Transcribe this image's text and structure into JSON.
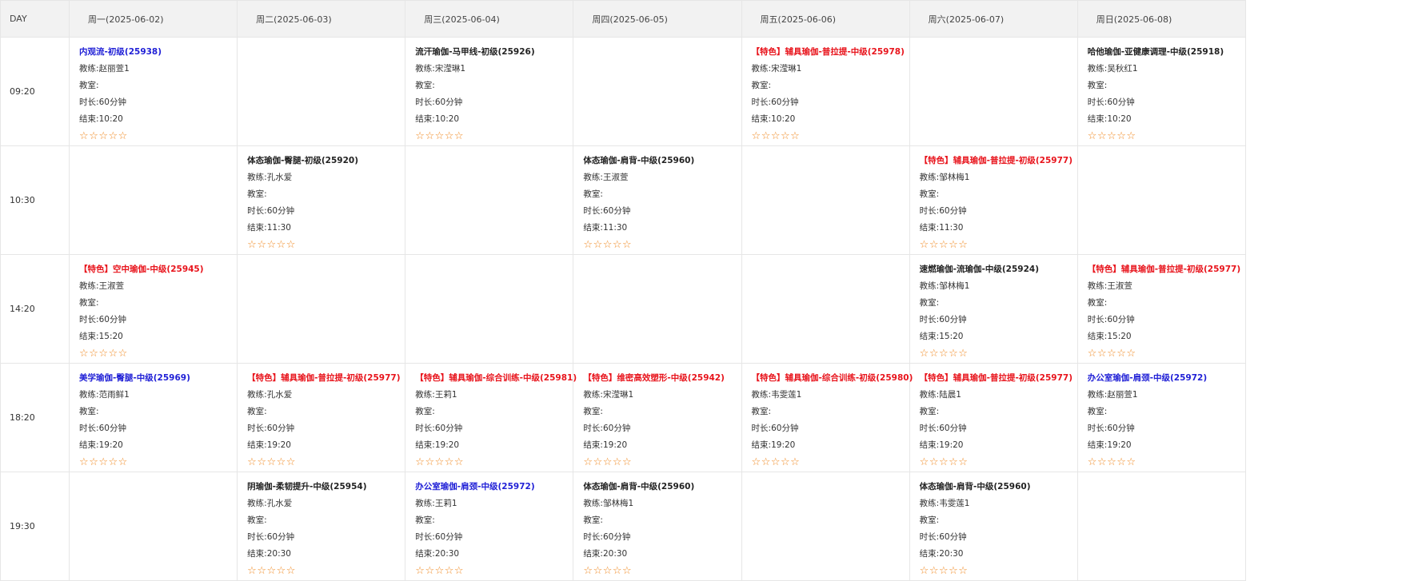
{
  "header": {
    "day_label": "DAY",
    "days": [
      "周一(2025-06-02)",
      "周二(2025-06-03)",
      "周三(2025-06-04)",
      "周四(2025-06-05)",
      "周五(2025-06-06)",
      "周六(2025-06-07)",
      "周日(2025-06-08)"
    ]
  },
  "labels": {
    "coach_prefix": "教练:",
    "room_prefix": "教室:",
    "duration_prefix": "时长:",
    "end_prefix": "结束:",
    "star_empty": "☆"
  },
  "colors": {
    "blue_title": "#1f1fd6",
    "red_title": "#e8141c",
    "star": "#f08a24"
  },
  "rows": [
    {
      "time": "09:20",
      "cells": [
        {
          "title": "内观流-初级(25938)",
          "color": "blue",
          "coach": "赵丽萱1",
          "room": "",
          "duration": "60分钟",
          "end": "10:20",
          "rating": 0
        },
        null,
        {
          "title": "流汗瑜伽-马甲线-初级(25926)",
          "color": "black",
          "coach": "宋滢琳1",
          "room": "",
          "duration": "60分钟",
          "end": "10:20",
          "rating": 0
        },
        null,
        {
          "title": "【特色】辅具瑜伽-普拉提-中级(25978)",
          "color": "red",
          "coach": "宋滢琳1",
          "room": "",
          "duration": "60分钟",
          "end": "10:20",
          "rating": 0
        },
        null,
        {
          "title": "哈他瑜伽-亚健康调理-中级(25918)",
          "color": "black",
          "coach": "吴秋红1",
          "room": "",
          "duration": "60分钟",
          "end": "10:20",
          "rating": 0
        }
      ]
    },
    {
      "time": "10:30",
      "cells": [
        null,
        {
          "title": "体态瑜伽-臀腿-初级(25920)",
          "color": "black",
          "coach": "孔水爱",
          "room": "",
          "duration": "60分钟",
          "end": "11:30",
          "rating": 0
        },
        null,
        {
          "title": "体态瑜伽-肩背-中级(25960)",
          "color": "black",
          "coach": "王淑萱",
          "room": "",
          "duration": "60分钟",
          "end": "11:30",
          "rating": 0
        },
        null,
        {
          "title": "【特色】辅具瑜伽-普拉提-初级(25977)",
          "color": "red",
          "coach": "邹林梅1",
          "room": "",
          "duration": "60分钟",
          "end": "11:30",
          "rating": 0
        },
        null
      ]
    },
    {
      "time": "14:20",
      "cells": [
        {
          "title": "【特色】空中瑜伽-中级(25945)",
          "color": "red",
          "coach": "王淑萱",
          "room": "",
          "duration": "60分钟",
          "end": "15:20",
          "rating": 0
        },
        null,
        null,
        null,
        null,
        {
          "title": "速燃瑜伽-流瑜伽-中级(25924)",
          "color": "black",
          "coach": "邹林梅1",
          "room": "",
          "duration": "60分钟",
          "end": "15:20",
          "rating": 0
        },
        {
          "title": "【特色】辅具瑜伽-普拉提-初级(25977)",
          "color": "red",
          "coach": "王淑萱",
          "room": "",
          "duration": "60分钟",
          "end": "15:20",
          "rating": 0
        }
      ]
    },
    {
      "time": "18:20",
      "cells": [
        {
          "title": "美学瑜伽-臀腿-中级(25969)",
          "color": "blue",
          "coach": "范雨鲜1",
          "room": "",
          "duration": "60分钟",
          "end": "19:20",
          "rating": 0
        },
        {
          "title": "【特色】辅具瑜伽-普拉提-初级(25977)",
          "color": "red",
          "coach": "孔水爱",
          "room": "",
          "duration": "60分钟",
          "end": "19:20",
          "rating": 0
        },
        {
          "title": "【特色】辅具瑜伽-综合训练-中级(25981)",
          "color": "red",
          "coach": "王莉1",
          "room": "",
          "duration": "60分钟",
          "end": "19:20",
          "rating": 0
        },
        {
          "title": "【特色】维密高效塑形-中级(25942)",
          "color": "red",
          "coach": "宋滢琳1",
          "room": "",
          "duration": "60分钟",
          "end": "19:20",
          "rating": 0
        },
        {
          "title": "【特色】辅具瑜伽-综合训练-初级(25980)",
          "color": "red",
          "coach": "韦雯莲1",
          "room": "",
          "duration": "60分钟",
          "end": "19:20",
          "rating": 0
        },
        {
          "title": "【特色】辅具瑜伽-普拉提-初级(25977)",
          "color": "red",
          "coach": "陆晨1",
          "room": "",
          "duration": "60分钟",
          "end": "19:20",
          "rating": 0
        },
        {
          "title": "办公室瑜伽-肩颈-中级(25972)",
          "color": "blue",
          "coach": "赵丽萱1",
          "room": "",
          "duration": "60分钟",
          "end": "19:20",
          "rating": 0
        }
      ]
    },
    {
      "time": "19:30",
      "cells": [
        null,
        {
          "title": "阴瑜伽-柔韧提升-中级(25954)",
          "color": "black",
          "coach": "孔水爱",
          "room": "",
          "duration": "60分钟",
          "end": "20:30",
          "rating": 0
        },
        {
          "title": "办公室瑜伽-肩颈-中级(25972)",
          "color": "blue",
          "coach": "王莉1",
          "room": "",
          "duration": "60分钟",
          "end": "20:30",
          "rating": 0
        },
        {
          "title": "体态瑜伽-肩背-中级(25960)",
          "color": "black",
          "coach": "邹林梅1",
          "room": "",
          "duration": "60分钟",
          "end": "20:30",
          "rating": 0
        },
        null,
        {
          "title": "体态瑜伽-肩背-中级(25960)",
          "color": "black",
          "coach": "韦雯莲1",
          "room": "",
          "duration": "60分钟",
          "end": "20:30",
          "rating": 0
        },
        null
      ]
    }
  ]
}
